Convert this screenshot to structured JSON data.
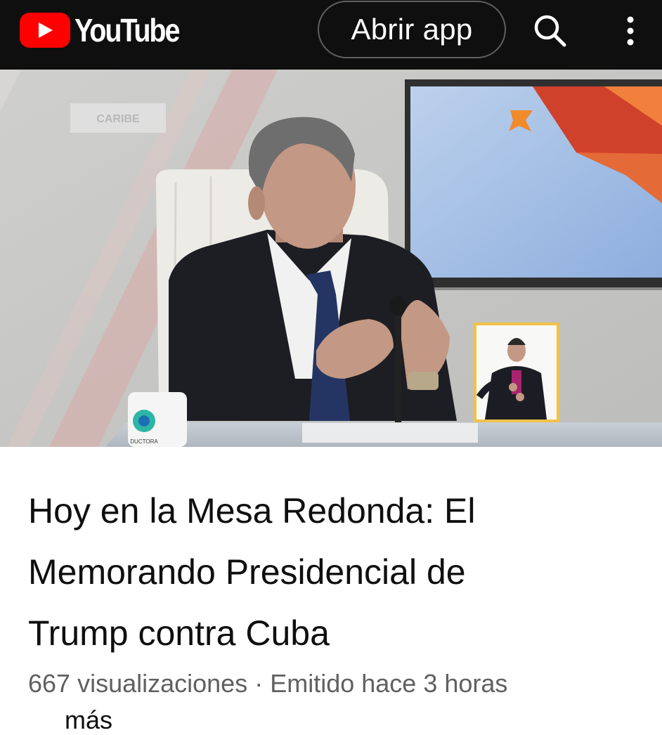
{
  "header": {
    "brand": "YouTube",
    "open_app_label": "Abrir app",
    "icons": [
      "youtube-logo-icon",
      "search-icon",
      "more-vert-icon"
    ]
  },
  "player": {
    "channel_watermark": "CARIBE",
    "mug_text": "DUCTORA"
  },
  "video": {
    "title_lines": [
      "Hoy en la Mesa Redonda: El",
      "Memorando Presidencial de",
      "Trump contra Cuba"
    ],
    "views": "667 visualizaciones",
    "separator": "·",
    "streamed": "Emitido hace 3 horas",
    "more_label": "más"
  },
  "colors": {
    "header_bg": "#0f0f0f",
    "brand_red": "#ff0000",
    "text_primary": "#0f0f0f",
    "text_secondary": "#606060"
  }
}
